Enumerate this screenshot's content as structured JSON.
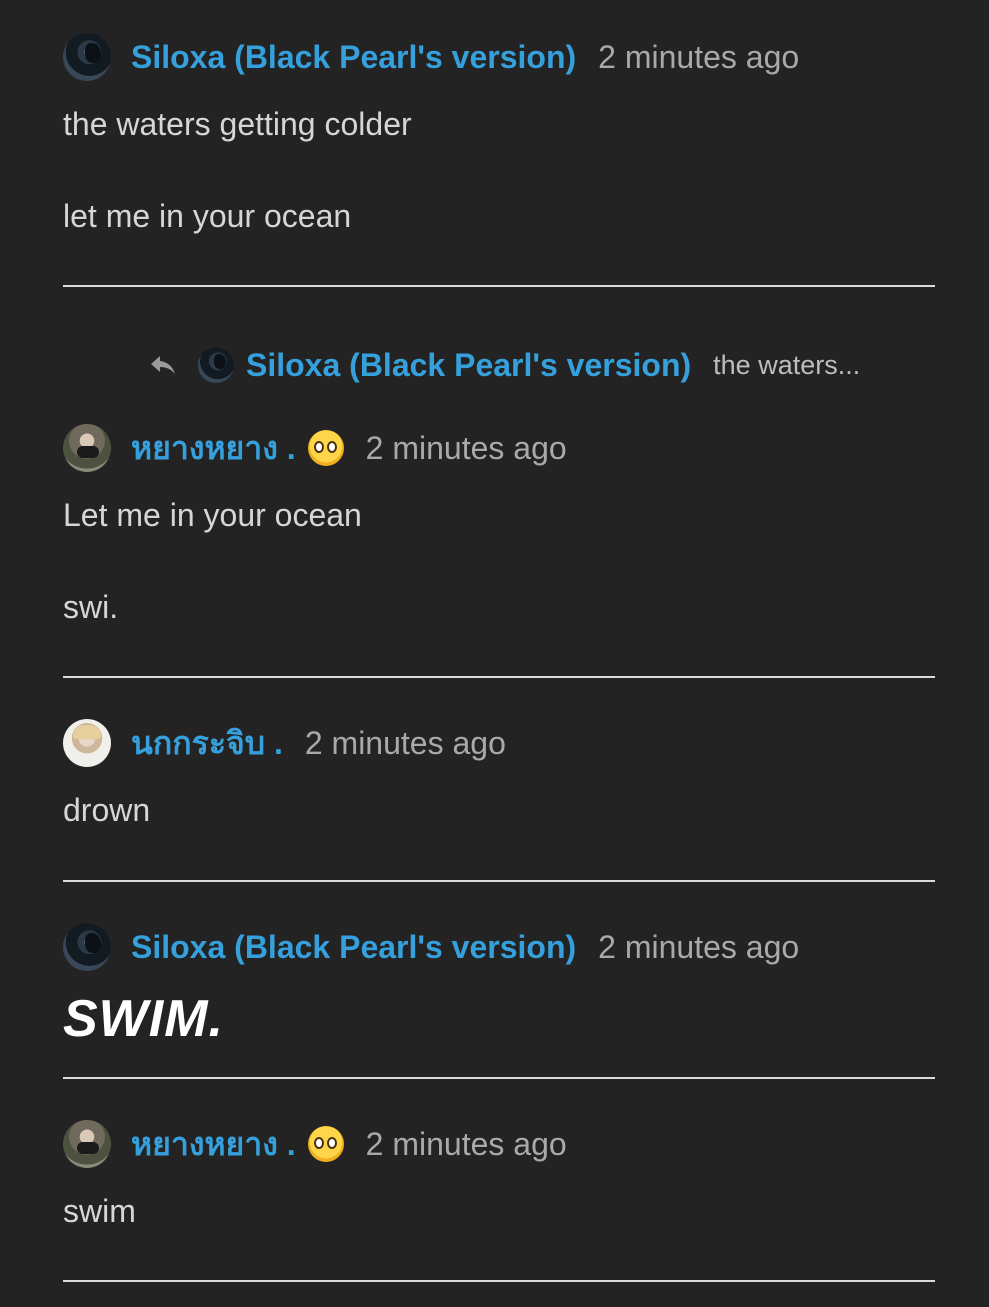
{
  "messages": [
    {
      "author": "Siloxa (Black Pearl's version)",
      "time": "2 minutes ago",
      "avatar_icon": "siloxa-avatar",
      "lines": [
        "the waters getting colder",
        "let me in your ocean"
      ]
    },
    {
      "reply_to": {
        "author": "Siloxa (Black Pearl's version)",
        "preview": "the waters..."
      },
      "author": "หยางหยาง .",
      "emoji": "pleading-face-emoji",
      "time": "2 minutes ago",
      "avatar_icon": "yang-avatar",
      "lines": [
        "Let me in your ocean",
        "swi."
      ]
    },
    {
      "author": "นกกระจิบ .",
      "time": "2 minutes ago",
      "avatar_icon": "nok-avatar",
      "lines": [
        "drown"
      ]
    },
    {
      "author": "Siloxa (Black Pearl's version)",
      "time": "2 minutes ago",
      "avatar_icon": "siloxa-avatar",
      "lines": [
        "SWIM."
      ]
    },
    {
      "author": "หยางหยาง .",
      "emoji": "pleading-face-emoji",
      "time": "2 minutes ago",
      "avatar_icon": "yang-avatar",
      "lines": [
        "swim"
      ]
    }
  ],
  "colors": {
    "background": "#232323",
    "author_name": "#35a0dc",
    "timestamp": "#a9a9a9",
    "text": "#d6d6d6",
    "divider": "#dadada"
  }
}
